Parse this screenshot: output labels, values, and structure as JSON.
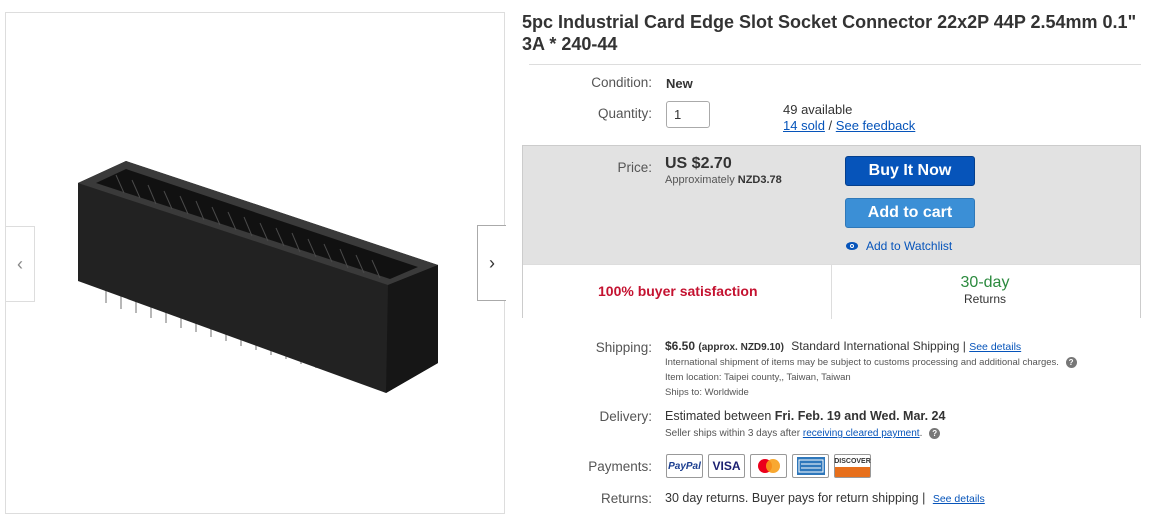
{
  "title": "5pc Industrial Card Edge Slot Socket Connector 22x2P 44P 2.54mm 0.1\" 3A * 240-44",
  "gallery": {
    "prev_glyph": "‹",
    "next_glyph": "›"
  },
  "condition": {
    "label": "Condition:",
    "value": "New"
  },
  "quantity": {
    "label": "Quantity:",
    "value": "1",
    "available": "49 available",
    "sold_link": "14 sold",
    "separator": "/",
    "feedback_link": "See feedback"
  },
  "price": {
    "label": "Price:",
    "value": "US $2.70",
    "approx_prefix": "Approximately",
    "approx_value": "NZD3.78"
  },
  "actions": {
    "buy_now": "Buy It Now",
    "add_to_cart": "Add to cart",
    "watchlist": "Add to Watchlist"
  },
  "satisfaction": "100% buyer satisfaction",
  "returns_badge": {
    "days": "30-day",
    "label": "Returns"
  },
  "shipping": {
    "label": "Shipping:",
    "cost": "$6.50",
    "approx": "(approx. NZD9.10)",
    "method": "Standard International Shipping |",
    "details_link": "See details",
    "note": "International shipment of items may be subject to customs processing and additional charges.",
    "location": "Item location:  Taipei county,, Taiwan, Taiwan",
    "ships_to": "Ships to:  Worldwide"
  },
  "delivery": {
    "label": "Delivery:",
    "prefix": "Estimated between",
    "dates": "Fri. Feb. 19 and Wed. Mar. 24",
    "note_prefix": "Seller ships within 3 days after",
    "note_link": "receiving cleared payment",
    "note_suffix": "."
  },
  "payments": {
    "label": "Payments:",
    "methods": [
      "PayPal",
      "VISA",
      "MasterCard",
      "American Express",
      "DISCOVER"
    ]
  },
  "returns": {
    "label": "Returns:",
    "value": "30 day returns. Buyer pays for return shipping |",
    "details_link": "See details"
  },
  "colors": {
    "link": "#0654ba",
    "buy_now": "#0654ba",
    "add_to_cart": "#3b8fd6",
    "satisfaction": "#c41230",
    "returns_days": "#2b8a3e"
  }
}
